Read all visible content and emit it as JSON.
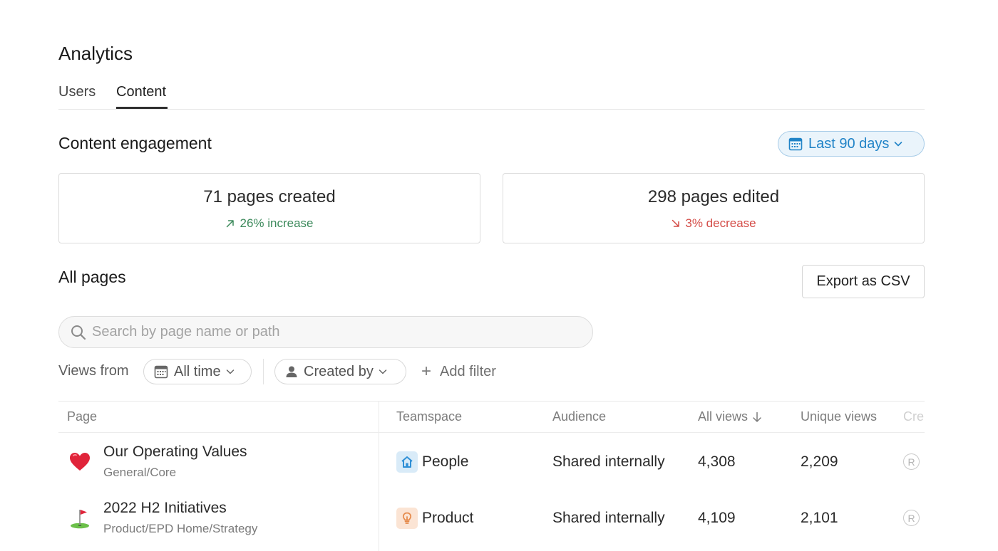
{
  "page": {
    "title": "Analytics"
  },
  "tabs": [
    {
      "label": "Users",
      "active": false
    },
    {
      "label": "Content",
      "active": true
    }
  ],
  "engagement": {
    "title": "Content engagement",
    "range_label": "Last 90 days",
    "range_icon": "calendar-icon",
    "cards": [
      {
        "main": "71 pages created",
        "change": "26% increase",
        "direction": "up",
        "color": "#3d8a5c",
        "icon": "arrow-up-right-icon"
      },
      {
        "main": "298 pages edited",
        "change": "3% decrease",
        "direction": "down",
        "color": "#d44c47",
        "icon": "arrow-down-right-icon"
      }
    ]
  },
  "all_pages": {
    "title": "All pages",
    "export_label": "Export as CSV",
    "search_placeholder": "Search by page name or path",
    "filters": {
      "views_from_label": "Views from",
      "time_label": "All time",
      "created_by_label": "Created by",
      "add_filter_label": "Add filter"
    },
    "columns": [
      "Page",
      "Teamspace",
      "Audience",
      "All views",
      "Unique views",
      "Cre"
    ],
    "sort": {
      "column": "All views",
      "direction": "desc"
    },
    "rows": [
      {
        "emoji": "heart-icon",
        "name": "Our Operating Values",
        "path": "General/Core",
        "teamspace": "People",
        "teamspace_icon": "home-icon",
        "teamspace_color": "#2f8fd6",
        "audience": "Shared internally",
        "all_views": "4,308",
        "unique_views": "2,209",
        "creator_initial": "R"
      },
      {
        "emoji": "golf-flag-icon",
        "name": "2022 H2 Initiatives",
        "path": "Product/EPD Home/Strategy",
        "teamspace": "Product",
        "teamspace_icon": "lightbulb-icon",
        "teamspace_color": "#e5894a",
        "audience": "Shared internally",
        "all_views": "4,109",
        "unique_views": "2,101",
        "creator_initial": "R"
      }
    ]
  }
}
